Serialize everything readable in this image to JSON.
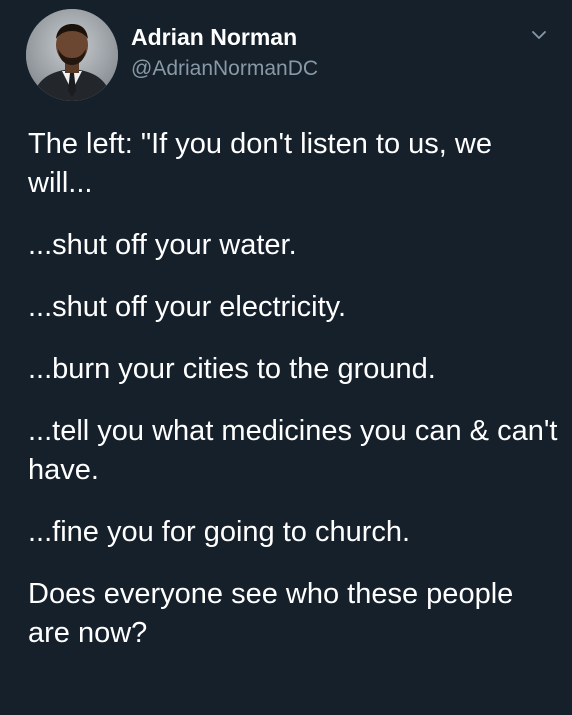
{
  "tweet": {
    "author_name": "Adrian Norman",
    "author_handle": "@AdrianNormanDC",
    "avatar_icon": "profile-photo",
    "menu_icon": "chevron-down-icon",
    "paragraphs": [
      "The left: \"If you don't listen to us, we will...",
      "...shut off your water.",
      "...shut off your electricity.",
      "...burn your cities to the ground.",
      "...tell you what medicines you can & can't have.",
      "...fine you for going to church.",
      "Does everyone see who these people are now?"
    ]
  },
  "colors": {
    "background": "#15202b",
    "text": "#ffffff",
    "secondary_text": "#8899a6"
  }
}
